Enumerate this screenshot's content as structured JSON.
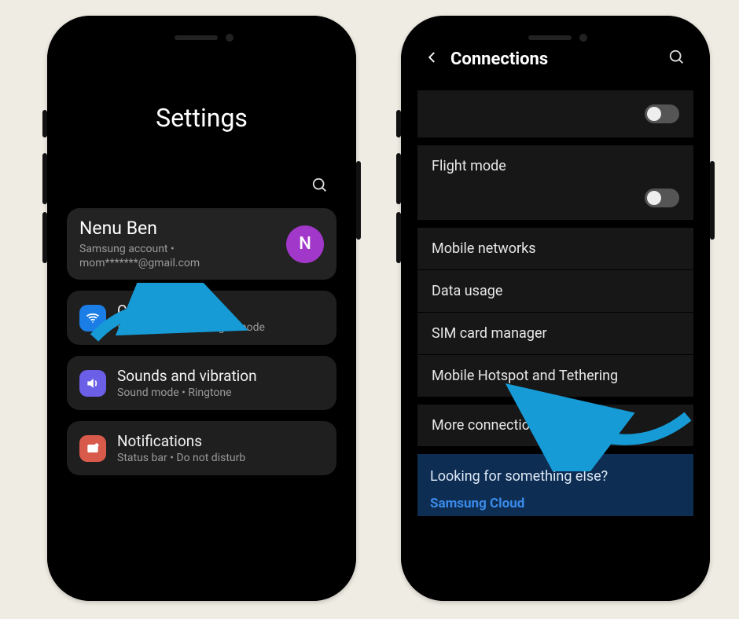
{
  "left": {
    "hero_title": "Settings",
    "account": {
      "name": "Nenu Ben",
      "line": "Samsung account  •",
      "email": "mom*******@gmail.com",
      "avatar_initial": "N"
    },
    "items": [
      {
        "title": "Connections",
        "sub": "Wi-Fi  •  Bluetooth  •  Flight mode",
        "icon": "wifi"
      },
      {
        "title": "Sounds and vibration",
        "sub": "Sound mode  •  Ringtone",
        "icon": "sound"
      },
      {
        "title": "Notifications",
        "sub": "Status bar  •  Do not disturb",
        "icon": "notif"
      }
    ]
  },
  "right": {
    "header_title": "Connections",
    "rows": {
      "top_toggle_on": false,
      "flight_mode": "Flight mode",
      "flight_mode_on": false,
      "mobile_networks": "Mobile networks",
      "data_usage": "Data usage",
      "sim_manager": "SIM card manager",
      "hotspot": "Mobile Hotspot and Tethering",
      "more": "More connection settings"
    },
    "footer": {
      "prompt": "Looking for something else?",
      "link": "Samsung Cloud"
    }
  },
  "colors": {
    "arrow": "#169bd7"
  }
}
